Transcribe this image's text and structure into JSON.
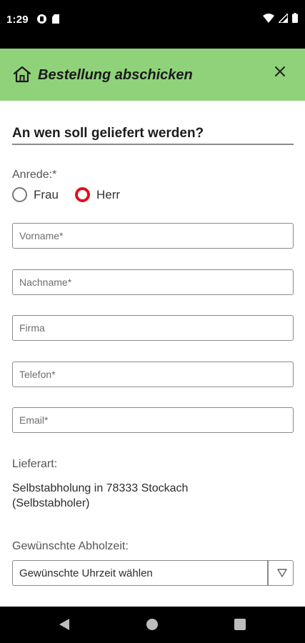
{
  "status_bar": {
    "time": "1:29",
    "left_icons": [
      "notification-icon",
      "sd-card-icon"
    ],
    "right_icons": [
      "wifi-icon",
      "signal-icon",
      "battery-icon"
    ]
  },
  "header": {
    "title": "Bestellung abschicken",
    "home_icon": "home-icon",
    "close_icon": "close-icon",
    "background_color": "#8fd27a"
  },
  "form": {
    "section_title": "An wen soll geliefert werden?",
    "salutation": {
      "label": "Anrede:*",
      "options": [
        {
          "label": "Frau",
          "checked": false
        },
        {
          "label": "Herr",
          "checked": true
        }
      ],
      "selected_color": "#e0101a"
    },
    "fields": {
      "vorname": {
        "placeholder": "Vorname*",
        "value": ""
      },
      "nachname": {
        "placeholder": "Nachname*",
        "value": ""
      },
      "firma": {
        "placeholder": "Firma",
        "value": ""
      },
      "telefon": {
        "placeholder": "Telefon*",
        "value": ""
      },
      "email": {
        "placeholder": "Email*",
        "value": ""
      }
    },
    "delivery": {
      "label": "Lieferart:",
      "value_line1": "Selbstabholung in 78333 Stockach",
      "value_line2": "(Selbstabholer)"
    },
    "pickup_time": {
      "label": "Gewünschte Abholzeit:",
      "selected": "Gewünschte Uhrzeit wählen"
    }
  },
  "nav_bar": {
    "icons": [
      "back-icon",
      "home-circle-icon",
      "recents-icon"
    ]
  }
}
